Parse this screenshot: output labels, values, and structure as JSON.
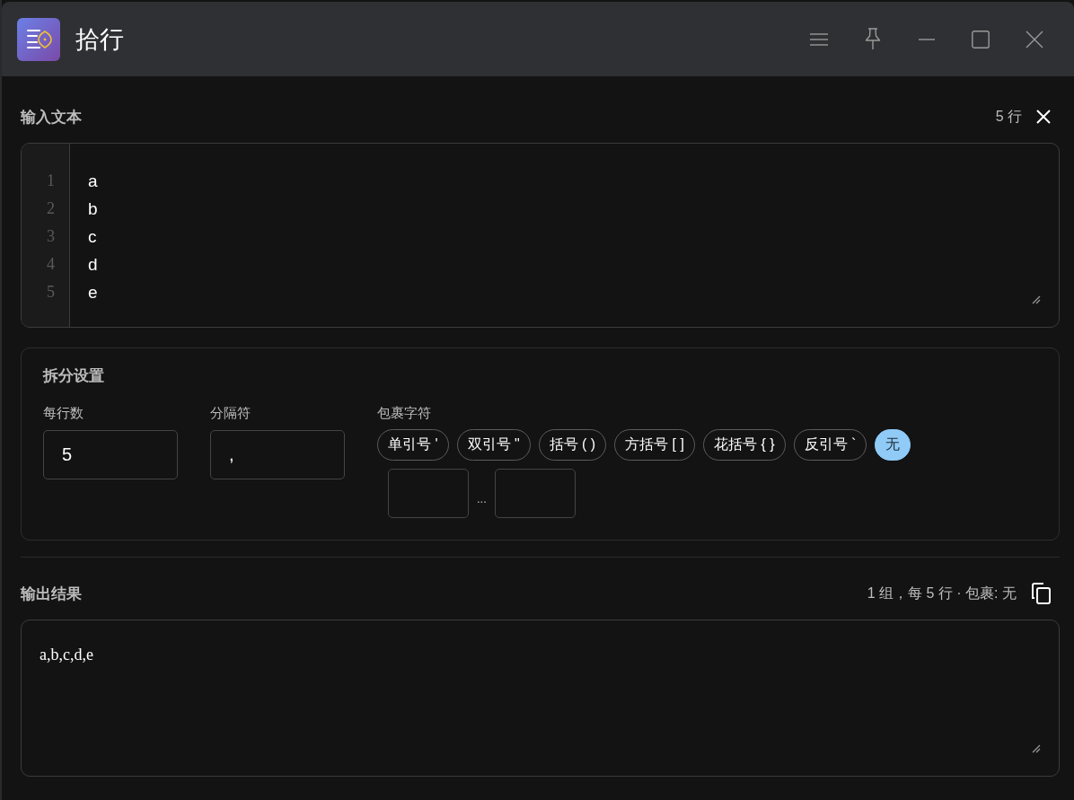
{
  "window": {
    "title": "拾行"
  },
  "input": {
    "title": "输入文本",
    "line_count": "5 行",
    "lines": [
      {
        "number": "1",
        "text": "a"
      },
      {
        "number": "2",
        "text": "b"
      },
      {
        "number": "3",
        "text": "c"
      },
      {
        "number": "4",
        "text": "d"
      },
      {
        "number": "5",
        "text": "e"
      }
    ]
  },
  "settings": {
    "title": "拆分设置",
    "fields": [
      {
        "label": "每行数",
        "value": "5"
      },
      {
        "label": "分隔符",
        "value": ","
      }
    ],
    "wrap": {
      "label": "包裹字符",
      "options": [
        {
          "label": "单引号 '",
          "selected": false
        },
        {
          "label": "双引号 \"",
          "selected": false
        },
        {
          "label": "括号 ( )",
          "selected": false
        },
        {
          "label": "方括号 [ ]",
          "selected": false
        },
        {
          "label": "花括号 { }",
          "selected": false
        },
        {
          "label": "反引号 `",
          "selected": false
        },
        {
          "label": "无",
          "selected": true
        }
      ],
      "custom_joiner": "..."
    }
  },
  "output": {
    "title": "输出结果",
    "summary": "1 组，每 5 行 · 包裹: 无",
    "text": "a,b,c,d,e"
  }
}
